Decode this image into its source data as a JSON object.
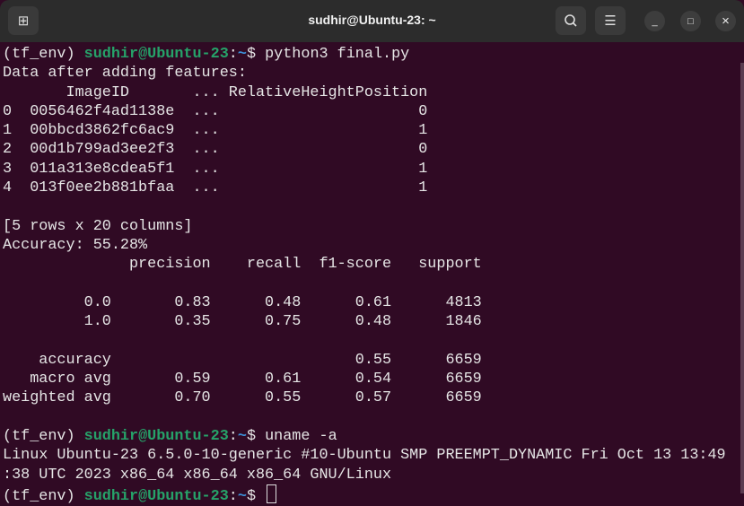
{
  "window": {
    "title": "sudhir@Ubuntu-23: ~",
    "new_tab_icon": "new-tab-icon",
    "search_icon": "search-icon",
    "menu_icon": "menu-icon",
    "minimize": "_",
    "maximize": "□",
    "close": "×"
  },
  "prompt": {
    "env": "(tf_env) ",
    "user_host": "sudhir@Ubuntu-23",
    "colon": ":",
    "path": "~",
    "dollar": "$ "
  },
  "commands": [
    "python3 final.py",
    "uname -a",
    ""
  ],
  "output1": [
    "Data after adding features:",
    "       ImageID       ... RelativeHeightPosition",
    "0  0056462f4ad1138e  ...                      0",
    "1  00bbcd3862fc6ac9  ...                      1",
    "2  00d1b799ad3ee2f3  ...                      0",
    "3  011a313e8cdea5f1  ...                      1",
    "4  013f0ee2b881bfaa  ...                      1",
    "",
    "[5 rows x 20 columns]",
    "Accuracy: 55.28%",
    "              precision    recall  f1-score   support",
    "",
    "         0.0       0.83      0.48      0.61      4813",
    "         1.0       0.35      0.75      0.48      1846",
    "",
    "    accuracy                           0.55      6659",
    "   macro avg       0.59      0.61      0.54      6659",
    "weighted avg       0.70      0.55      0.57      6659",
    ""
  ],
  "output2": [
    "Linux Ubuntu-23 6.5.0-10-generic #10-Ubuntu SMP PREEMPT_DYNAMIC Fri Oct 13 13:49",
    ":38 UTC 2023 x86_64 x86_64 x86_64 GNU/Linux"
  ]
}
